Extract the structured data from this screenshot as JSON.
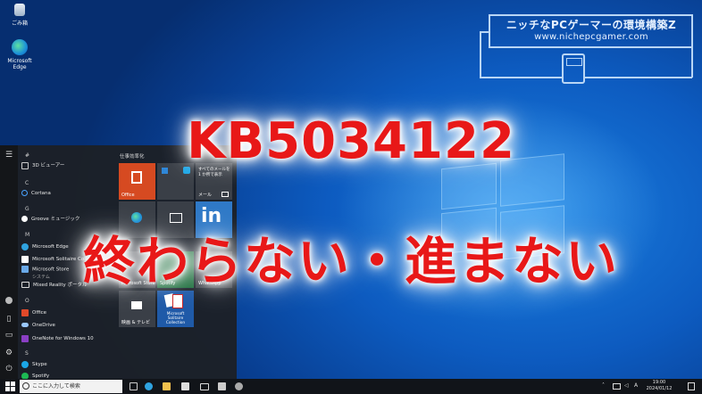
{
  "headline": {
    "line1": "KB5034122",
    "line2": "終わらない・進まない"
  },
  "watermark": {
    "title": "ニッチなPCゲーマーの環境構築Z",
    "url": "www.nichepcgamer.com"
  },
  "desktop_icons": [
    {
      "label": "ごみ箱",
      "icon": "recycle-bin-icon"
    },
    {
      "label": "Microsoft Edge",
      "icon": "edge-icon"
    }
  ],
  "start_menu": {
    "app_list": [
      {
        "type": "header",
        "label": "#"
      },
      {
        "type": "app",
        "label": "3D ビューアー",
        "icon": "cube-icon"
      },
      {
        "type": "header",
        "label": "C"
      },
      {
        "type": "app",
        "label": "Cortana",
        "icon": "cortana-icon"
      },
      {
        "type": "header",
        "label": "G"
      },
      {
        "type": "app",
        "label": "Groove ミュージック",
        "icon": "groove-icon"
      },
      {
        "type": "header",
        "label": "M"
      },
      {
        "type": "app",
        "label": "Microsoft Edge",
        "icon": "edge-icon"
      },
      {
        "type": "app",
        "label": "Microsoft Solitaire Collection",
        "icon": "cards-icon"
      },
      {
        "type": "app",
        "label": "Microsoft Store",
        "sub": "システム",
        "icon": "store-icon"
      },
      {
        "type": "app",
        "label": "Mixed Reality ポータル",
        "icon": "mixed-reality-icon"
      },
      {
        "type": "header",
        "label": "O"
      },
      {
        "type": "app",
        "label": "Office",
        "icon": "office-icon"
      },
      {
        "type": "app",
        "label": "OneDrive",
        "icon": "onedrive-icon"
      },
      {
        "type": "app",
        "label": "OneNote for Windows 10",
        "icon": "onenote-icon"
      },
      {
        "type": "header",
        "label": "S"
      },
      {
        "type": "app",
        "label": "Skype",
        "icon": "skype-icon"
      },
      {
        "type": "app",
        "label": "Spotify",
        "icon": "spotify-icon"
      }
    ],
    "tiles_header": "仕事効率化",
    "tiles": [
      {
        "label": "Office",
        "icon": "office-icon"
      },
      {
        "label": "",
        "icon": "apps-group-icon"
      },
      {
        "label": "すべてのメールを 1 か所で表示",
        "icon": "mail-icon"
      },
      {
        "label": "メール",
        "icon": "mail-icon"
      },
      {
        "label": "",
        "icon": "edge-icon"
      },
      {
        "label": "",
        "icon": "photos-icon"
      },
      {
        "label": "in",
        "icon": "linkedin-icon"
      },
      {
        "label": "Microsoft Store",
        "icon": "store-icon"
      },
      {
        "label": "Spotify",
        "icon": "spotify-icon"
      },
      {
        "label": "WhatsApp",
        "icon": "whatsapp-icon"
      },
      {
        "label": "映画 & テレビ",
        "icon": "movies-icon"
      },
      {
        "label": "Microsoft Solitaire Collection",
        "icon": "cards-icon"
      }
    ]
  },
  "taskbar": {
    "search_placeholder": "ここに入力して検索",
    "time": "19:00",
    "date": "2024/01/12",
    "ime": "A",
    "colors": {
      "bar": "#111419",
      "accent": "#0a63c9"
    }
  }
}
